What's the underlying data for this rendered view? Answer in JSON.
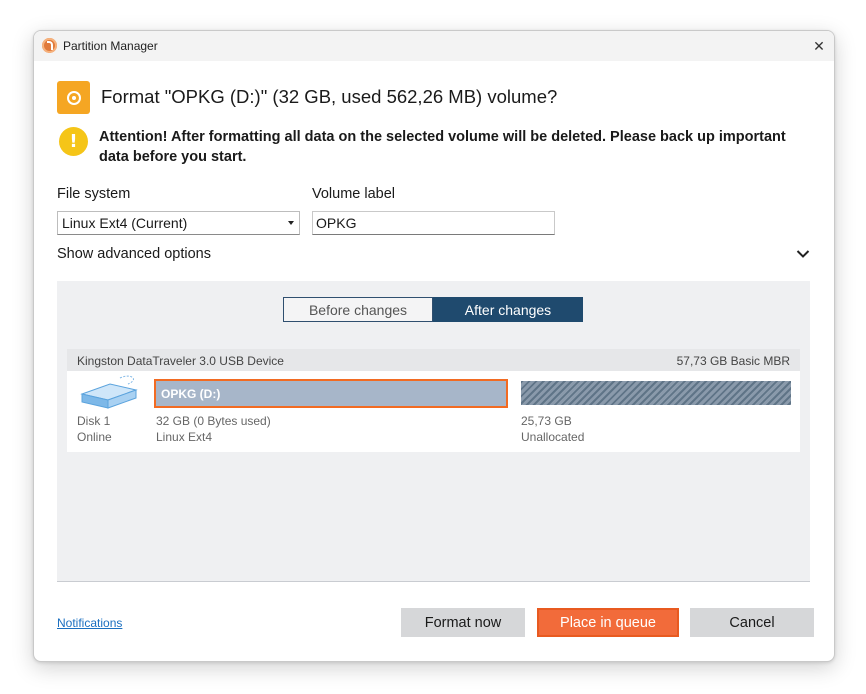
{
  "window": {
    "app_title": "Partition Manager",
    "close_glyph": "✕"
  },
  "dialog": {
    "title": "Format \"OPKG (D:)\" (32 GB, used 562,26 MB) volume?",
    "warning": "Attention! After formatting all data on the selected volume will be deleted. Please back up important data before you start.",
    "warning_glyph": "!"
  },
  "form": {
    "file_system_label": "File system",
    "file_system_value": "Linux Ext4 (Current)",
    "volume_label_label": "Volume label",
    "volume_label_value": "OPKG",
    "advanced_label": "Show advanced options"
  },
  "preview": {
    "tabs": [
      {
        "label": "Before changes",
        "selected": false
      },
      {
        "label": "After changes",
        "selected": true
      }
    ],
    "disk": {
      "name": "Kingston DataTraveler 3.0 USB Device",
      "summary": "57,73 GB Basic MBR",
      "disk_label": "Disk 1",
      "status": "Online",
      "partitions": [
        {
          "name": "OPKG (D:)",
          "size": "32 GB (0 Bytes used)",
          "fs": "Linux Ext4",
          "selected": true
        },
        {
          "name": "",
          "size": "25,73 GB",
          "fs": "Unallocated",
          "selected": false
        }
      ]
    }
  },
  "footer": {
    "notifications": "Notifications",
    "format_now": "Format now",
    "place_in_queue": "Place in queue",
    "cancel": "Cancel"
  },
  "colors": {
    "accent_orange": "#f26b3a",
    "selected_tab": "#1f4a6e",
    "partition_fill": "#a7b6c9",
    "warning_yellow": "#f5c518",
    "header_icon": "#f5a623"
  },
  "icons": {
    "app": "partition-manager-icon",
    "header": "format-disk-icon",
    "warning": "exclamation-icon",
    "chevron": "chevron-down-icon",
    "disk": "hard-disk-icon"
  }
}
